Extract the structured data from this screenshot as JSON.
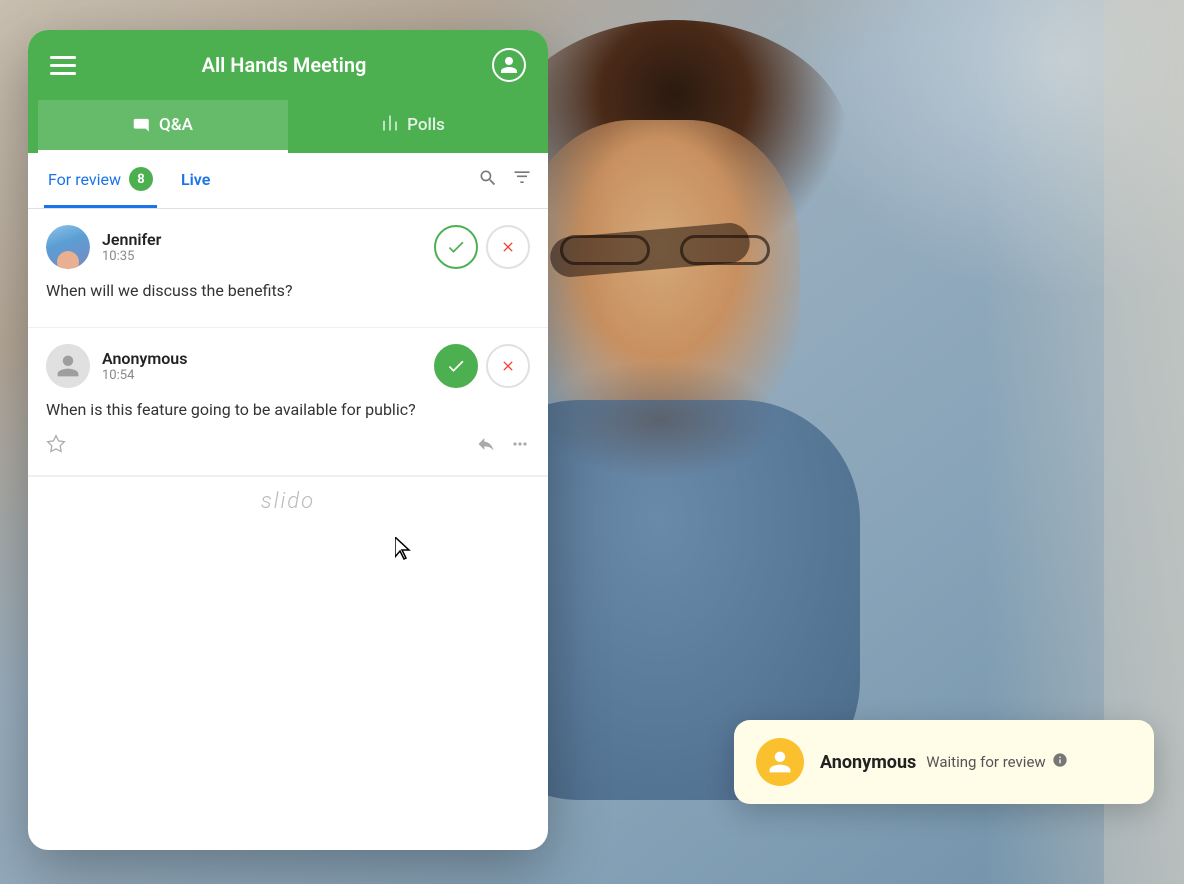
{
  "header": {
    "title": "All Hands Meeting",
    "menu_icon": "☰",
    "user_icon": "👤"
  },
  "tabs": [
    {
      "id": "qa",
      "label": "Q&A",
      "icon": "💬",
      "active": true
    },
    {
      "id": "polls",
      "label": "Polls",
      "icon": "📊",
      "active": false
    }
  ],
  "sub_tabs": [
    {
      "id": "for_review",
      "label": "For review",
      "badge": "8",
      "active": true
    },
    {
      "id": "live",
      "label": "Live",
      "active": false
    }
  ],
  "questions": [
    {
      "id": "q1",
      "author": "Jennifer",
      "time": "10:35",
      "text": "When will we discuss the benefits?",
      "approved": false,
      "avatar_type": "jennifer"
    },
    {
      "id": "q2",
      "author": "Anonymous",
      "time": "10:54",
      "text": "When is this feature going to be available for public?",
      "approved": true,
      "avatar_type": "anonymous"
    }
  ],
  "notification": {
    "author": "Anonymous",
    "status": "Waiting for review",
    "avatar_icon": "👤"
  },
  "branding": {
    "text": "slido"
  },
  "colors": {
    "green": "#4caf50",
    "blue": "#1a73e8",
    "red": "#f44336",
    "yellow_bg": "#fffde7",
    "orange_avatar": "#fbc02d"
  }
}
